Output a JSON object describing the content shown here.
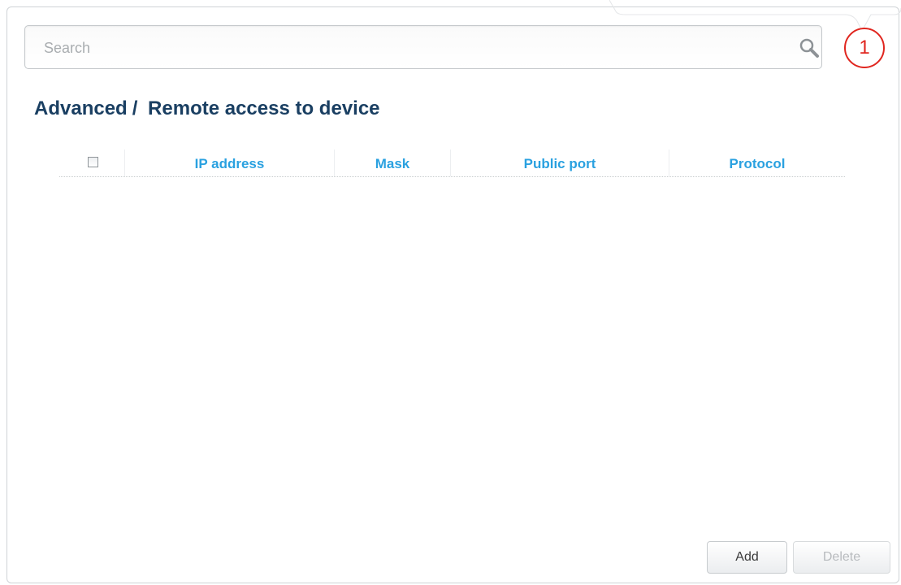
{
  "search": {
    "placeholder": "Search",
    "value": ""
  },
  "callout": {
    "number": "1",
    "color": "#e0261f"
  },
  "breadcrumb": {
    "section": "Advanced",
    "separator": "/",
    "page": "Remote access to device"
  },
  "table": {
    "columns": [
      {
        "label": "IP address"
      },
      {
        "label": "Mask"
      },
      {
        "label": "Public port"
      },
      {
        "label": "Protocol"
      }
    ],
    "rows": [],
    "select_all_checked": false
  },
  "actions": {
    "add_label": "Add",
    "delete_label": "Delete",
    "delete_enabled": false
  },
  "icons": {
    "search": "search-icon",
    "checkbox": "checkbox-icon"
  },
  "colors": {
    "title": "#1a3f62",
    "header_text": "#2aa1e0",
    "callout": "#e0261f"
  }
}
